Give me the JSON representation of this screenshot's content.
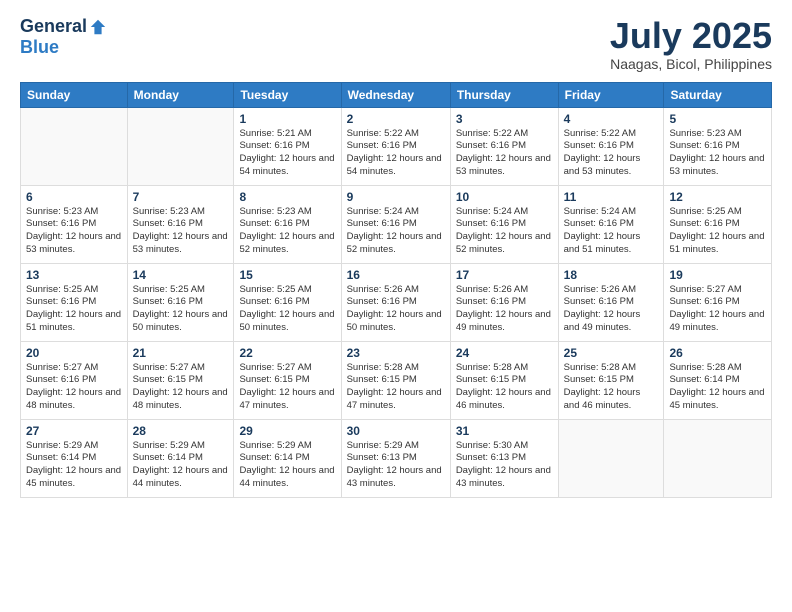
{
  "logo": {
    "general": "General",
    "blue": "Blue"
  },
  "title": "July 2025",
  "location": "Naagas, Bicol, Philippines",
  "days_of_week": [
    "Sunday",
    "Monday",
    "Tuesday",
    "Wednesday",
    "Thursday",
    "Friday",
    "Saturday"
  ],
  "weeks": [
    [
      {
        "day": "",
        "sunrise": "",
        "sunset": "",
        "daylight": ""
      },
      {
        "day": "",
        "sunrise": "",
        "sunset": "",
        "daylight": ""
      },
      {
        "day": "1",
        "sunrise": "Sunrise: 5:21 AM",
        "sunset": "Sunset: 6:16 PM",
        "daylight": "Daylight: 12 hours and 54 minutes."
      },
      {
        "day": "2",
        "sunrise": "Sunrise: 5:22 AM",
        "sunset": "Sunset: 6:16 PM",
        "daylight": "Daylight: 12 hours and 54 minutes."
      },
      {
        "day": "3",
        "sunrise": "Sunrise: 5:22 AM",
        "sunset": "Sunset: 6:16 PM",
        "daylight": "Daylight: 12 hours and 53 minutes."
      },
      {
        "day": "4",
        "sunrise": "Sunrise: 5:22 AM",
        "sunset": "Sunset: 6:16 PM",
        "daylight": "Daylight: 12 hours and 53 minutes."
      },
      {
        "day": "5",
        "sunrise": "Sunrise: 5:23 AM",
        "sunset": "Sunset: 6:16 PM",
        "daylight": "Daylight: 12 hours and 53 minutes."
      }
    ],
    [
      {
        "day": "6",
        "sunrise": "Sunrise: 5:23 AM",
        "sunset": "Sunset: 6:16 PM",
        "daylight": "Daylight: 12 hours and 53 minutes."
      },
      {
        "day": "7",
        "sunrise": "Sunrise: 5:23 AM",
        "sunset": "Sunset: 6:16 PM",
        "daylight": "Daylight: 12 hours and 53 minutes."
      },
      {
        "day": "8",
        "sunrise": "Sunrise: 5:23 AM",
        "sunset": "Sunset: 6:16 PM",
        "daylight": "Daylight: 12 hours and 52 minutes."
      },
      {
        "day": "9",
        "sunrise": "Sunrise: 5:24 AM",
        "sunset": "Sunset: 6:16 PM",
        "daylight": "Daylight: 12 hours and 52 minutes."
      },
      {
        "day": "10",
        "sunrise": "Sunrise: 5:24 AM",
        "sunset": "Sunset: 6:16 PM",
        "daylight": "Daylight: 12 hours and 52 minutes."
      },
      {
        "day": "11",
        "sunrise": "Sunrise: 5:24 AM",
        "sunset": "Sunset: 6:16 PM",
        "daylight": "Daylight: 12 hours and 51 minutes."
      },
      {
        "day": "12",
        "sunrise": "Sunrise: 5:25 AM",
        "sunset": "Sunset: 6:16 PM",
        "daylight": "Daylight: 12 hours and 51 minutes."
      }
    ],
    [
      {
        "day": "13",
        "sunrise": "Sunrise: 5:25 AM",
        "sunset": "Sunset: 6:16 PM",
        "daylight": "Daylight: 12 hours and 51 minutes."
      },
      {
        "day": "14",
        "sunrise": "Sunrise: 5:25 AM",
        "sunset": "Sunset: 6:16 PM",
        "daylight": "Daylight: 12 hours and 50 minutes."
      },
      {
        "day": "15",
        "sunrise": "Sunrise: 5:25 AM",
        "sunset": "Sunset: 6:16 PM",
        "daylight": "Daylight: 12 hours and 50 minutes."
      },
      {
        "day": "16",
        "sunrise": "Sunrise: 5:26 AM",
        "sunset": "Sunset: 6:16 PM",
        "daylight": "Daylight: 12 hours and 50 minutes."
      },
      {
        "day": "17",
        "sunrise": "Sunrise: 5:26 AM",
        "sunset": "Sunset: 6:16 PM",
        "daylight": "Daylight: 12 hours and 49 minutes."
      },
      {
        "day": "18",
        "sunrise": "Sunrise: 5:26 AM",
        "sunset": "Sunset: 6:16 PM",
        "daylight": "Daylight: 12 hours and 49 minutes."
      },
      {
        "day": "19",
        "sunrise": "Sunrise: 5:27 AM",
        "sunset": "Sunset: 6:16 PM",
        "daylight": "Daylight: 12 hours and 49 minutes."
      }
    ],
    [
      {
        "day": "20",
        "sunrise": "Sunrise: 5:27 AM",
        "sunset": "Sunset: 6:16 PM",
        "daylight": "Daylight: 12 hours and 48 minutes."
      },
      {
        "day": "21",
        "sunrise": "Sunrise: 5:27 AM",
        "sunset": "Sunset: 6:15 PM",
        "daylight": "Daylight: 12 hours and 48 minutes."
      },
      {
        "day": "22",
        "sunrise": "Sunrise: 5:27 AM",
        "sunset": "Sunset: 6:15 PM",
        "daylight": "Daylight: 12 hours and 47 minutes."
      },
      {
        "day": "23",
        "sunrise": "Sunrise: 5:28 AM",
        "sunset": "Sunset: 6:15 PM",
        "daylight": "Daylight: 12 hours and 47 minutes."
      },
      {
        "day": "24",
        "sunrise": "Sunrise: 5:28 AM",
        "sunset": "Sunset: 6:15 PM",
        "daylight": "Daylight: 12 hours and 46 minutes."
      },
      {
        "day": "25",
        "sunrise": "Sunrise: 5:28 AM",
        "sunset": "Sunset: 6:15 PM",
        "daylight": "Daylight: 12 hours and 46 minutes."
      },
      {
        "day": "26",
        "sunrise": "Sunrise: 5:28 AM",
        "sunset": "Sunset: 6:14 PM",
        "daylight": "Daylight: 12 hours and 45 minutes."
      }
    ],
    [
      {
        "day": "27",
        "sunrise": "Sunrise: 5:29 AM",
        "sunset": "Sunset: 6:14 PM",
        "daylight": "Daylight: 12 hours and 45 minutes."
      },
      {
        "day": "28",
        "sunrise": "Sunrise: 5:29 AM",
        "sunset": "Sunset: 6:14 PM",
        "daylight": "Daylight: 12 hours and 44 minutes."
      },
      {
        "day": "29",
        "sunrise": "Sunrise: 5:29 AM",
        "sunset": "Sunset: 6:14 PM",
        "daylight": "Daylight: 12 hours and 44 minutes."
      },
      {
        "day": "30",
        "sunrise": "Sunrise: 5:29 AM",
        "sunset": "Sunset: 6:13 PM",
        "daylight": "Daylight: 12 hours and 43 minutes."
      },
      {
        "day": "31",
        "sunrise": "Sunrise: 5:30 AM",
        "sunset": "Sunset: 6:13 PM",
        "daylight": "Daylight: 12 hours and 43 minutes."
      },
      {
        "day": "",
        "sunrise": "",
        "sunset": "",
        "daylight": ""
      },
      {
        "day": "",
        "sunrise": "",
        "sunset": "",
        "daylight": ""
      }
    ]
  ]
}
